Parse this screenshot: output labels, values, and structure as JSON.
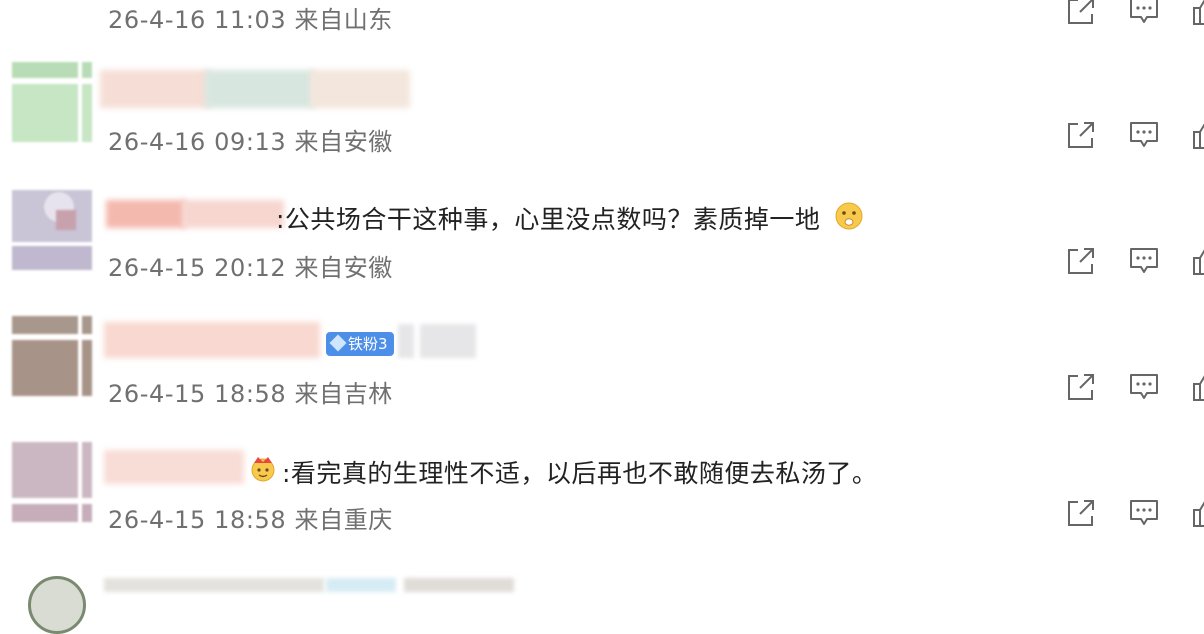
{
  "comments": [
    {
      "text": "",
      "time": "26-4-16 11:03",
      "location": "来自山东"
    },
    {
      "text": "",
      "time": "26-4-16 09:13",
      "location": "来自安徽"
    },
    {
      "text": ":公共场合干这种事，心里没点数吗？素质掉一地",
      "time": "26-4-15 20:12",
      "location": "来自安徽",
      "emoji": "hushed-face-emoji"
    },
    {
      "text": "",
      "time": "26-4-15 18:58",
      "location": "来自吉林",
      "badge": "铁粉3"
    },
    {
      "text": ":看完真的生理性不适，以后再也不敢随便去私汤了。",
      "time": "26-4-15 18:58",
      "location": "来自重庆",
      "emoji": "crown-emoji"
    }
  ],
  "actions": {
    "share": "share-icon",
    "comment": "comment-icon",
    "like": "like-icon"
  }
}
